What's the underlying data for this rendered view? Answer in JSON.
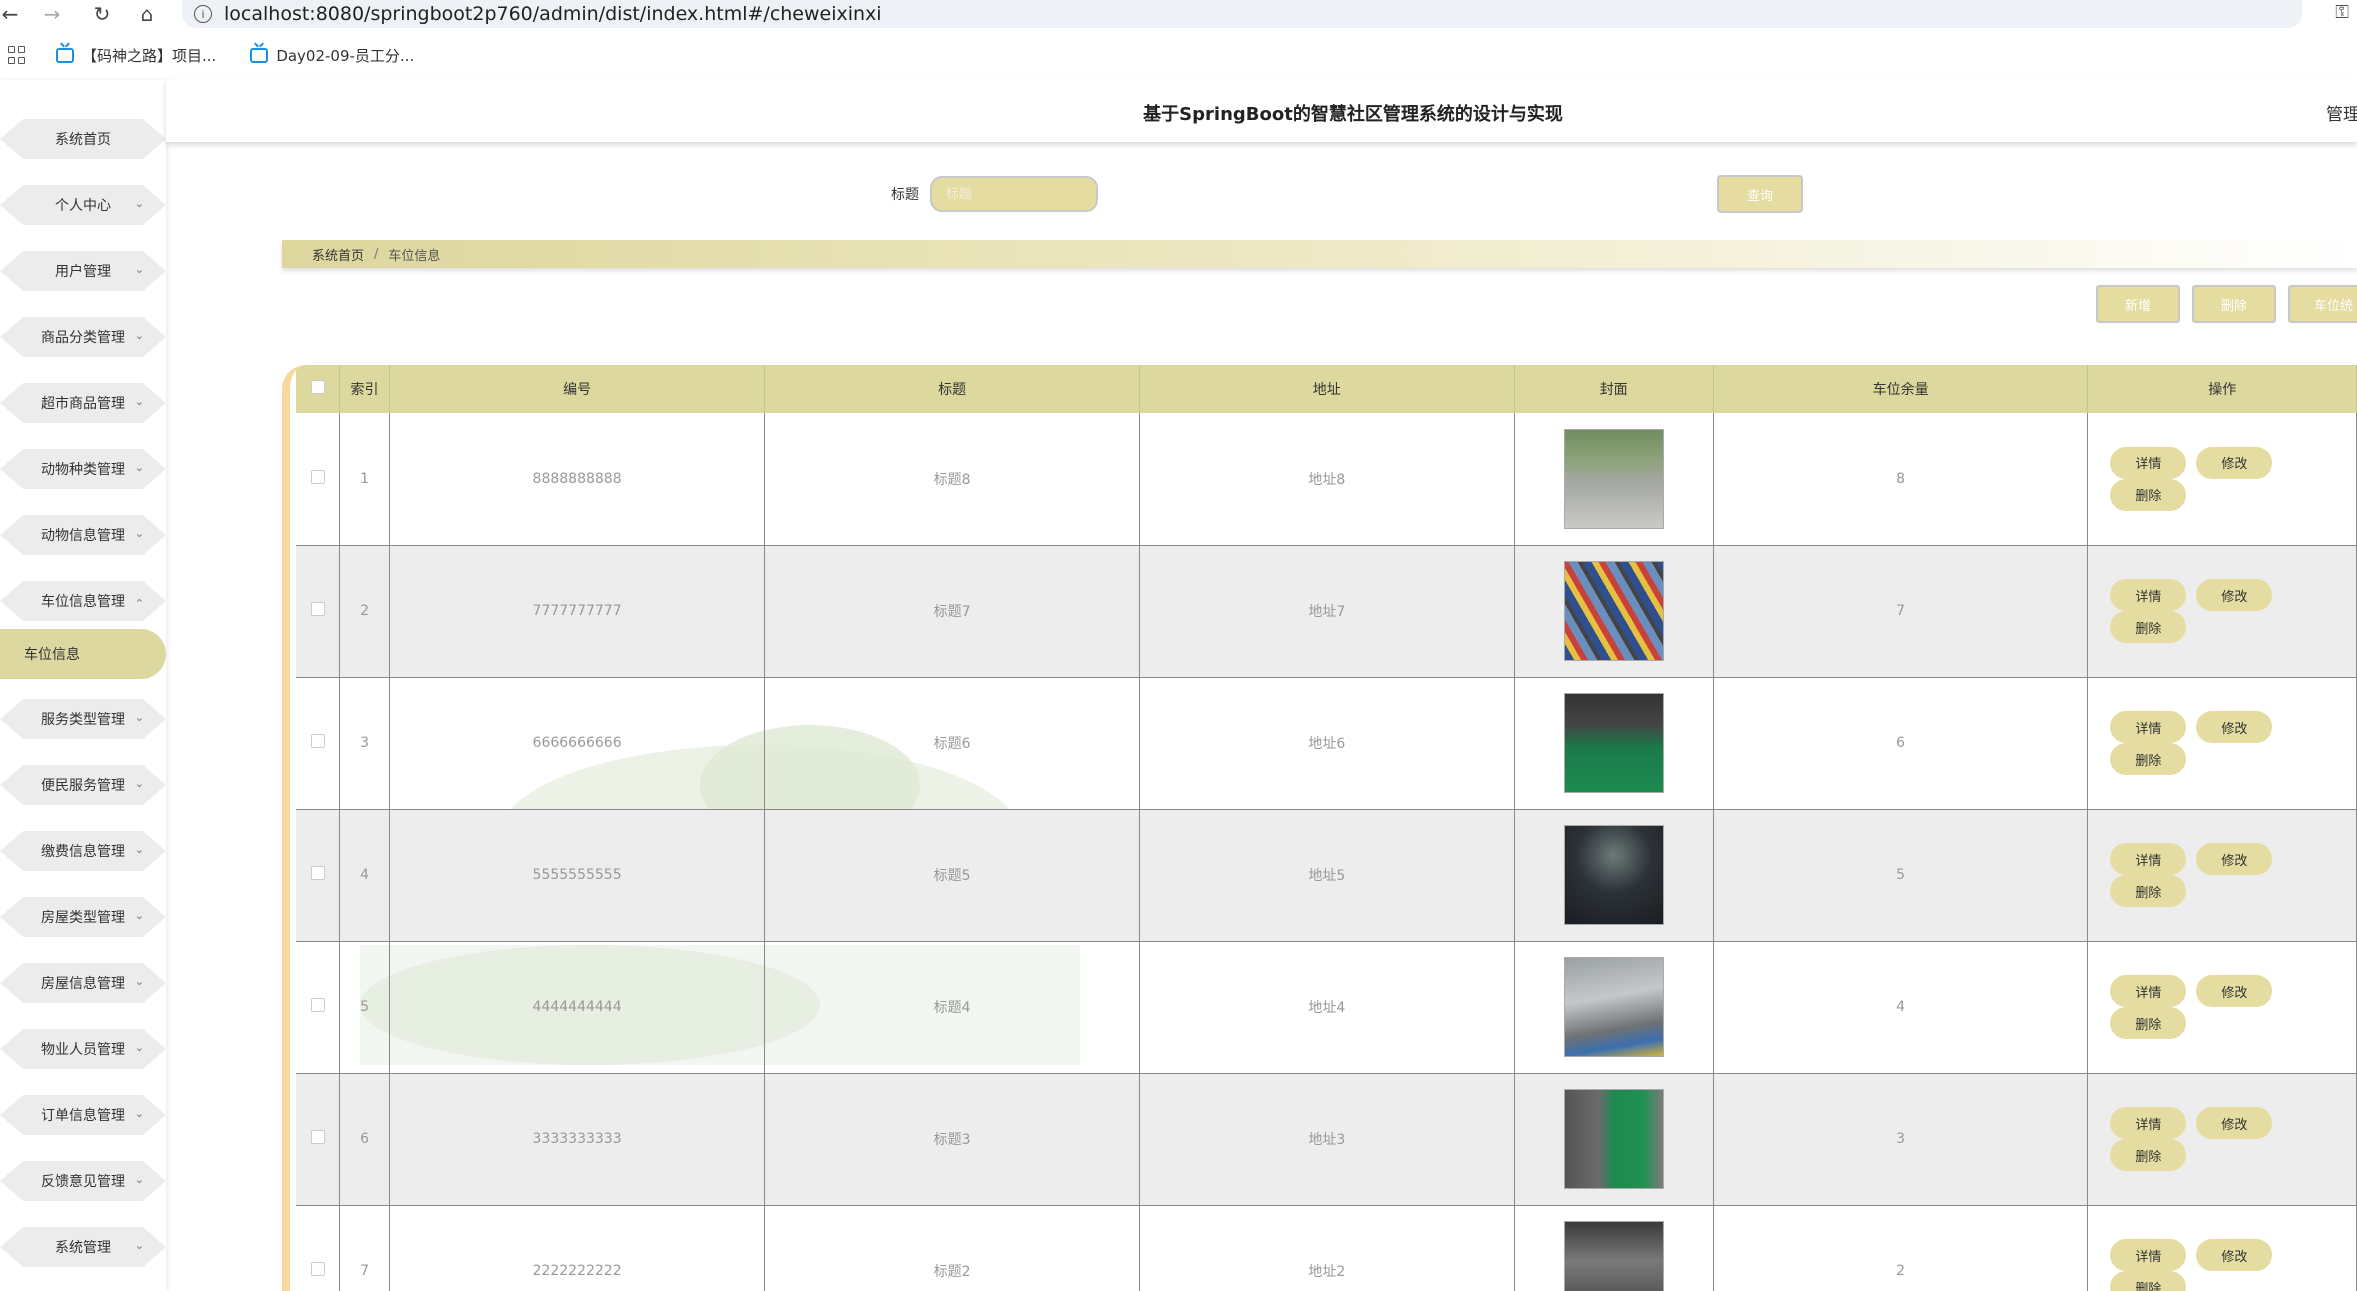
{
  "browser": {
    "url": "localhost:8080/springboot2p760/admin/dist/index.html#/cheweixinxi",
    "bookmarks": [
      {
        "label": "【码神之路】项目..."
      },
      {
        "label": "Day02-09-员工分..."
      }
    ]
  },
  "header": {
    "title": "基于SpringBoot的智慧社区管理系统的设计与实现",
    "right_text": "管理"
  },
  "sidebar": {
    "items": [
      {
        "label": "系统首页",
        "chevron": ""
      },
      {
        "label": "个人中心",
        "chevron": "⌄"
      },
      {
        "label": "用户管理",
        "chevron": "⌄"
      },
      {
        "label": "商品分类管理",
        "chevron": "⌄"
      },
      {
        "label": "超市商品管理",
        "chevron": "⌄"
      },
      {
        "label": "动物种类管理",
        "chevron": "⌄"
      },
      {
        "label": "动物信息管理",
        "chevron": "⌄"
      },
      {
        "label": "车位信息管理",
        "chevron": "⌃"
      },
      {
        "label": "服务类型管理",
        "chevron": "⌄"
      },
      {
        "label": "便民服务管理",
        "chevron": "⌄"
      },
      {
        "label": "缴费信息管理",
        "chevron": "⌄"
      },
      {
        "label": "房屋类型管理",
        "chevron": "⌄"
      },
      {
        "label": "房屋信息管理",
        "chevron": "⌄"
      },
      {
        "label": "物业人员管理",
        "chevron": "⌄"
      },
      {
        "label": "订单信息管理",
        "chevron": "⌄"
      },
      {
        "label": "反馈意见管理",
        "chevron": "⌄"
      },
      {
        "label": "系统管理",
        "chevron": "⌄"
      }
    ],
    "active_sub": "车位信息"
  },
  "search": {
    "label": "标题",
    "placeholder": "标题",
    "button": "查询"
  },
  "breadcrumb": {
    "home": "系统首页",
    "separator": "/",
    "current": "车位信息"
  },
  "actions": {
    "add": "新增",
    "delete": "删除",
    "stats": "车位统"
  },
  "table": {
    "columns": [
      "",
      "索引",
      "编号",
      "标题",
      "地址",
      "封面",
      "车位余量",
      "操作"
    ],
    "rows": [
      {
        "index": "1",
        "code": "8888888888",
        "title": "标题8",
        "address": "地址8",
        "remaining": "8"
      },
      {
        "index": "2",
        "code": "7777777777",
        "title": "标题7",
        "address": "地址7",
        "remaining": "7"
      },
      {
        "index": "3",
        "code": "6666666666",
        "title": "标题6",
        "address": "地址6",
        "remaining": "6"
      },
      {
        "index": "4",
        "code": "5555555555",
        "title": "标题5",
        "address": "地址5",
        "remaining": "5"
      },
      {
        "index": "5",
        "code": "4444444444",
        "title": "标题4",
        "address": "地址4",
        "remaining": "4"
      },
      {
        "index": "6",
        "code": "3333333333",
        "title": "标题3",
        "address": "地址3",
        "remaining": "3"
      },
      {
        "index": "7",
        "code": "2222222222",
        "title": "标题2",
        "address": "地址2",
        "remaining": "2"
      }
    ],
    "row_actions": {
      "detail": "详情",
      "edit": "修改",
      "delete": "删除"
    }
  },
  "icons": {
    "back": "←",
    "forward": "→",
    "reload": "↻",
    "home": "⌂",
    "info": "i",
    "key": "⚿"
  },
  "colors": {
    "accent": "#e4dca0",
    "header_row": "#ddd89e",
    "table_border_left": "#f7d9a0",
    "sidebar_active": "#ddd8a0"
  }
}
